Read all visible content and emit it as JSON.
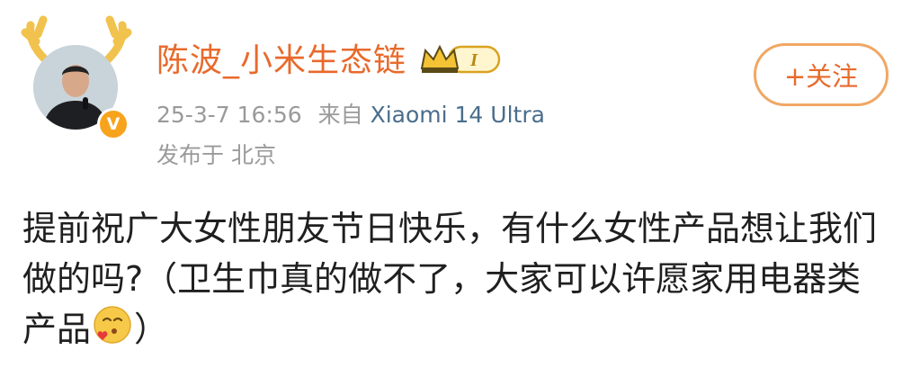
{
  "post": {
    "username": "陈波_小米生态链",
    "level_badge": "I",
    "time": "25-3-7 16:56",
    "source_prefix": "来自",
    "device": "Xiaomi 14 Ultra",
    "location": "发布于 北京",
    "follow_label": "+关注",
    "text_main": "提前祝广大女性朋友节日快乐，有什么女性产品想让我们做的吗?（卫生巾真的做不了，大家可以许愿家用电器类产品",
    "text_close": "）",
    "emoji_name": "blowing-kiss-emoji"
  },
  "colors": {
    "username": "#e86a2c",
    "verified_badge": "#f7a31c",
    "device_link": "#4a6d8c",
    "meta_text": "#9a9a9a",
    "follow_border": "#f0a764"
  }
}
